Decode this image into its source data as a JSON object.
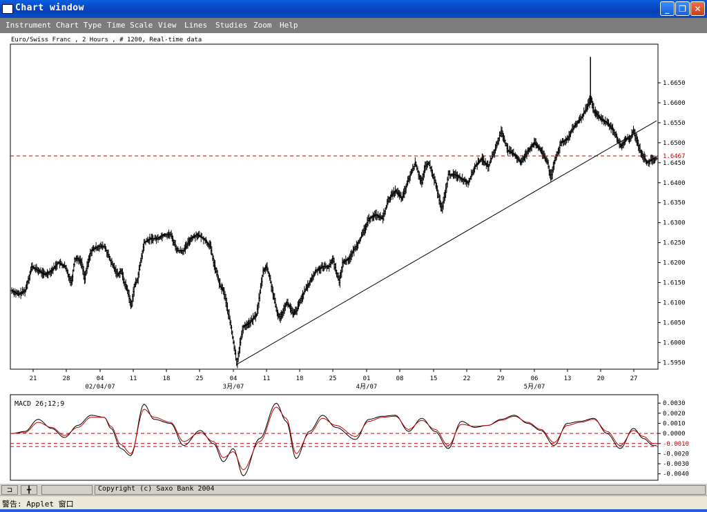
{
  "window": {
    "title": "Chart window"
  },
  "menu": [
    "Instrument",
    "Chart Type",
    "Time Scale",
    "View",
    "Lines",
    "Studies",
    "Zoom",
    "Help"
  ],
  "chart_info": "Euro/Swiss Franc , 2 Hours , # 1200, Real-time data",
  "price_axis": [
    "1.6650",
    "1.6600",
    "1.6550",
    "1.6500",
    "1.6450",
    "1.6400",
    "1.6350",
    "1.6300",
    "1.6250",
    "1.6200",
    "1.6150",
    "1.6100",
    "1.6050",
    "1.6000",
    "1.5950"
  ],
  "current_price": "1.6467",
  "date_axis": {
    "days": [
      "21",
      "28",
      "04",
      "11",
      "18",
      "25",
      "04",
      "11",
      "18",
      "25",
      "01",
      "08",
      "15",
      "22",
      "29",
      "06",
      "13",
      "20",
      "27"
    ],
    "months": [
      "02/04/07",
      "3月/07",
      "4月/07",
      "5月/07"
    ]
  },
  "macd": {
    "label": "MACD 26;12;9",
    "axis": [
      "0.0030",
      "0.0020",
      "0.0010",
      "0.0000",
      "-0.0010",
      "-0.0020",
      "-0.0030",
      "-0.0040"
    ]
  },
  "copyright": "Copyright (c) Saxo Bank 2004",
  "applet_status": "警告: Applet 窗口",
  "chart_data": [
    {
      "type": "ohlc",
      "title": "Euro/Swiss Franc , 2 Hours , # 1200, Real-time data",
      "ylim": [
        1.5935,
        1.6745
      ],
      "x_ticks": [
        "21",
        "28",
        "04",
        "11",
        "18",
        "25",
        "04",
        "11",
        "18",
        "25",
        "01",
        "08",
        "15",
        "22",
        "29",
        "06",
        "13",
        "20",
        "27"
      ],
      "x_months": [
        "02/04/07",
        "3月/07",
        "4月/07",
        "5月/07"
      ],
      "close_path": [
        [
          0,
          1.613
        ],
        [
          2,
          1.612
        ],
        [
          4,
          1.613
        ],
        [
          6,
          1.619
        ],
        [
          8,
          1.618
        ],
        [
          10,
          1.617
        ],
        [
          12,
          1.618
        ],
        [
          14,
          1.62
        ],
        [
          16,
          1.619
        ],
        [
          18,
          1.615
        ],
        [
          19,
          1.621
        ],
        [
          20,
          1.621
        ],
        [
          21,
          1.62
        ],
        [
          22,
          1.616
        ],
        [
          23,
          1.62
        ],
        [
          24,
          1.623
        ],
        [
          26,
          1.624
        ],
        [
          28,
          1.624
        ],
        [
          30,
          1.62
        ],
        [
          32,
          1.617
        ],
        [
          33,
          1.618
        ],
        [
          34,
          1.615
        ],
        [
          35,
          1.613
        ],
        [
          36,
          1.609
        ],
        [
          37,
          1.614
        ],
        [
          38,
          1.616
        ],
        [
          40,
          1.625
        ],
        [
          42,
          1.626
        ],
        [
          44,
          1.626
        ],
        [
          46,
          1.627
        ],
        [
          48,
          1.627
        ],
        [
          50,
          1.623
        ],
        [
          52,
          1.623
        ],
        [
          54,
          1.626
        ],
        [
          56,
          1.627
        ],
        [
          58,
          1.626
        ],
        [
          60,
          1.624
        ],
        [
          61,
          1.62
        ],
        [
          62,
          1.617
        ],
        [
          63,
          1.614
        ],
        [
          64,
          1.613
        ],
        [
          65,
          1.609
        ],
        [
          66,
          1.605
        ],
        [
          67,
          1.6
        ],
        [
          68,
          1.5945
        ],
        [
          69,
          1.6
        ],
        [
          70,
          1.604
        ],
        [
          72,
          1.605
        ],
        [
          74,
          1.607
        ],
        [
          76,
          1.618
        ],
        [
          77,
          1.619
        ],
        [
          78,
          1.616
        ],
        [
          79,
          1.612
        ],
        [
          80,
          1.608
        ],
        [
          81,
          1.606
        ],
        [
          82,
          1.608
        ],
        [
          83,
          1.61
        ],
        [
          84,
          1.609
        ],
        [
          85,
          1.607
        ],
        [
          86,
          1.608
        ],
        [
          88,
          1.612
        ],
        [
          90,
          1.615
        ],
        [
          92,
          1.618
        ],
        [
          94,
          1.619
        ],
        [
          96,
          1.619
        ],
        [
          97,
          1.621
        ],
        [
          98,
          1.618
        ],
        [
          99,
          1.615
        ],
        [
          100,
          1.62
        ],
        [
          102,
          1.621
        ],
        [
          104,
          1.624
        ],
        [
          106,
          1.627
        ],
        [
          108,
          1.631
        ],
        [
          110,
          1.632
        ],
        [
          112,
          1.631
        ],
        [
          114,
          1.636
        ],
        [
          116,
          1.638
        ],
        [
          118,
          1.636
        ],
        [
          120,
          1.641
        ],
        [
          122,
          1.645
        ],
        [
          123,
          1.642
        ],
        [
          124,
          1.64
        ],
        [
          125,
          1.644
        ],
        [
          126,
          1.645
        ],
        [
          128,
          1.64
        ],
        [
          130,
          1.633
        ],
        [
          132,
          1.642
        ],
        [
          134,
          1.642
        ],
        [
          136,
          1.641
        ],
        [
          138,
          1.64
        ],
        [
          140,
          1.644
        ],
        [
          142,
          1.646
        ],
        [
          144,
          1.644
        ],
        [
          146,
          1.648
        ],
        [
          148,
          1.653
        ],
        [
          150,
          1.648
        ],
        [
          152,
          1.647
        ],
        [
          154,
          1.645
        ],
        [
          156,
          1.648
        ],
        [
          158,
          1.65
        ],
        [
          159,
          1.649
        ],
        [
          160,
          1.648
        ],
        [
          162,
          1.645
        ],
        [
          163,
          1.641
        ],
        [
          164,
          1.645
        ],
        [
          166,
          1.65
        ],
        [
          168,
          1.651
        ],
        [
          170,
          1.654
        ],
        [
          172,
          1.656
        ],
        [
          174,
          1.659
        ],
        [
          175,
          1.661
        ],
        [
          176,
          1.658
        ],
        [
          177,
          1.657
        ],
        [
          178,
          1.656
        ],
        [
          180,
          1.655
        ],
        [
          182,
          1.653
        ],
        [
          183,
          1.651
        ],
        [
          184,
          1.649
        ],
        [
          186,
          1.651
        ],
        [
          187,
          1.651
        ],
        [
          188,
          1.653
        ],
        [
          190,
          1.648
        ],
        [
          192,
          1.645
        ],
        [
          194,
          1.646
        ]
      ],
      "reference_line": 1.6467,
      "trendline": {
        "from": [
          68,
          1.5945
        ],
        "to": [
          195,
          1.6555
        ]
      },
      "spike": {
        "x": 175,
        "low": 1.6595,
        "high": 1.6715
      }
    },
    {
      "type": "line",
      "title": "MACD 26;12;9",
      "ylim": [
        -0.0045,
        0.0037
      ],
      "reference_lines": [
        0.0,
        -0.001,
        -0.0013
      ],
      "series": [
        {
          "values": [
            [
              0,
              0.0
            ],
            [
              4,
              0.0002
            ],
            [
              8,
              0.0014
            ],
            [
              12,
              0.0005
            ],
            [
              16,
              -0.0004
            ],
            [
              20,
              0.0008
            ],
            [
              24,
              0.0018
            ],
            [
              28,
              0.0016
            ],
            [
              30,
              0.0005
            ],
            [
              33,
              -0.0015
            ],
            [
              36,
              -0.0022
            ],
            [
              40,
              0.0029
            ],
            [
              43,
              0.0014
            ],
            [
              48,
              0.001
            ],
            [
              52,
              -0.0012
            ],
            [
              57,
              0.0003
            ],
            [
              61,
              -0.001
            ],
            [
              64,
              -0.0028
            ],
            [
              67,
              -0.0015
            ],
            [
              70,
              -0.0042
            ],
            [
              75,
              -0.0005
            ],
            [
              80,
              0.003
            ],
            [
              83,
              0.0012
            ],
            [
              86,
              -0.0025
            ],
            [
              90,
              0.0002
            ],
            [
              94,
              0.0018
            ],
            [
              98,
              0.0006
            ],
            [
              104,
              -0.0006
            ],
            [
              108,
              0.0014
            ],
            [
              112,
              0.0017
            ],
            [
              116,
              0.0018
            ],
            [
              120,
              0.0002
            ],
            [
              124,
              0.0015
            ],
            [
              128,
              0.0002
            ],
            [
              132,
              -0.0015
            ],
            [
              136,
              0.0012
            ],
            [
              140,
              0.0006
            ],
            [
              144,
              0.0008
            ],
            [
              148,
              0.0014
            ],
            [
              152,
              0.0018
            ],
            [
              156,
              0.001
            ],
            [
              160,
              0.0003
            ],
            [
              164,
              -0.0012
            ],
            [
              168,
              0.001
            ],
            [
              172,
              0.0012
            ],
            [
              176,
              0.0015
            ],
            [
              180,
              0.0
            ],
            [
              184,
              -0.0015
            ],
            [
              188,
              0.0005
            ],
            [
              191,
              -0.0005
            ],
            [
              194,
              -0.0012
            ]
          ]
        },
        {
          "values": [
            [
              0,
              0.0
            ],
            [
              4,
              0.0001
            ],
            [
              8,
              0.0011
            ],
            [
              12,
              0.0006
            ],
            [
              16,
              -0.0002
            ],
            [
              20,
              0.0006
            ],
            [
              24,
              0.0016
            ],
            [
              28,
              0.0016
            ],
            [
              30,
              0.0007
            ],
            [
              33,
              -0.0011
            ],
            [
              36,
              -0.002
            ],
            [
              40,
              0.0024
            ],
            [
              43,
              0.0016
            ],
            [
              48,
              0.0011
            ],
            [
              52,
              -0.0008
            ],
            [
              57,
              0.0001
            ],
            [
              61,
              -0.0008
            ],
            [
              64,
              -0.0024
            ],
            [
              67,
              -0.0018
            ],
            [
              70,
              -0.0036
            ],
            [
              75,
              -0.0008
            ],
            [
              80,
              0.0026
            ],
            [
              83,
              0.0015
            ],
            [
              86,
              -0.002
            ],
            [
              90,
              0.0
            ],
            [
              94,
              0.0015
            ],
            [
              98,
              0.0008
            ],
            [
              104,
              -0.0003
            ],
            [
              108,
              0.0012
            ],
            [
              112,
              0.0016
            ],
            [
              116,
              0.0017
            ],
            [
              120,
              0.0004
            ],
            [
              124,
              0.0013
            ],
            [
              128,
              0.0004
            ],
            [
              132,
              -0.0012
            ],
            [
              136,
              0.0009
            ],
            [
              140,
              0.0007
            ],
            [
              144,
              0.0008
            ],
            [
              148,
              0.0013
            ],
            [
              152,
              0.0017
            ],
            [
              156,
              0.0011
            ],
            [
              160,
              0.0004
            ],
            [
              164,
              -0.0009
            ],
            [
              168,
              0.0008
            ],
            [
              172,
              0.0011
            ],
            [
              176,
              0.0014
            ],
            [
              180,
              0.0002
            ],
            [
              184,
              -0.0012
            ],
            [
              188,
              0.0003
            ],
            [
              191,
              -0.0003
            ],
            [
              194,
              -0.001
            ]
          ]
        }
      ]
    }
  ]
}
